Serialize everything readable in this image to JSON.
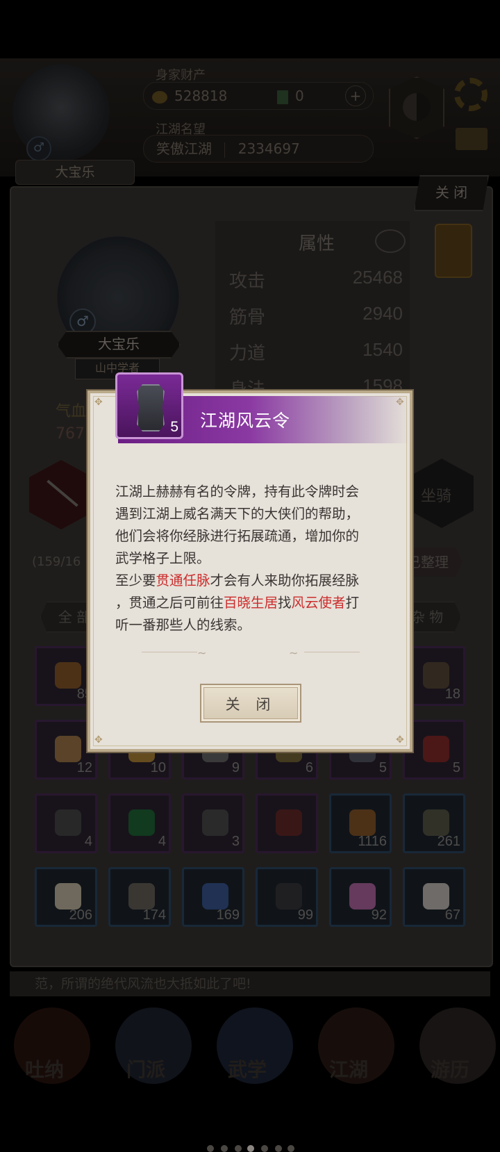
{
  "header": {
    "player_name": "大宝乐",
    "assets_label": "身家财产",
    "coins": "528818",
    "jade": "0",
    "fame_label": "江湖名望",
    "fame_rank": "笑傲江湖",
    "fame_value": "2334697",
    "add_symbol": "+"
  },
  "panel": {
    "close_label": "关 闭",
    "char_name": "大宝乐",
    "char_title": "山中学者",
    "attr_heading": "属性",
    "attributes": [
      {
        "name": "攻击",
        "value": "25468"
      },
      {
        "name": "筋骨",
        "value": "2940"
      },
      {
        "name": "力道",
        "value": "1540"
      },
      {
        "name": "身法",
        "value": "1598"
      }
    ],
    "hp_label": "气血",
    "hp_value": "767",
    "mount_label": "坐骑",
    "bag_count": "(159/16",
    "sort_label": "已整理",
    "filter_all": "全 部",
    "filter_misc": "杂 物"
  },
  "grid": [
    {
      "count": "85",
      "color": "#8a5a2a"
    },
    {
      "count": "",
      "color": ""
    },
    {
      "count": "",
      "color": ""
    },
    {
      "count": "",
      "color": ""
    },
    {
      "count": "",
      "color": ""
    },
    {
      "count": "18",
      "color": "#5a4a3a"
    },
    {
      "count": "12",
      "color": "#a57a4a"
    },
    {
      "count": "10",
      "color": "#b88a3a"
    },
    {
      "count": "9",
      "color": "#6a6a6a"
    },
    {
      "count": "6",
      "color": "#7a6a3a"
    },
    {
      "count": "5",
      "color": "#5a5a6a"
    },
    {
      "count": "5",
      "color": "#8a2a2a"
    },
    {
      "count": "4",
      "color": "#4a4a4a"
    },
    {
      "count": "4",
      "color": "#1f6a3a"
    },
    {
      "count": "3",
      "color": "#4e4e4e"
    },
    {
      "count": "",
      "color": "#6a2a2a"
    },
    {
      "count": "1116",
      "color": "#8a5a2a"
    },
    {
      "count": "261",
      "color": "#5a5a4a"
    },
    {
      "count": "206",
      "color": "#c8bfa8"
    },
    {
      "count": "174",
      "color": "#6a655e"
    },
    {
      "count": "169",
      "color": "#3b5a9a"
    },
    {
      "count": "99",
      "color": "#3a3a3e"
    },
    {
      "count": "92",
      "color": "#b86aa8"
    },
    {
      "count": "67",
      "color": "#c8c3bd"
    }
  ],
  "message_bar": "范，所谓的绝代风流也大抵如此了吧!",
  "nav": [
    "吐纳",
    "门派",
    "武学",
    "江湖",
    "游历"
  ],
  "dialog": {
    "item_name": "江湖风云令",
    "item_count": "5",
    "desc_line1": "江湖上赫赫有名的令牌，持有此令牌时会",
    "desc_line2": "遇到江湖上威名满天下的大侠们的帮助，",
    "desc_line3": "他们会将你经脉进行拓展疏通，增加你的",
    "desc_line4": "武学格子上限。",
    "desc_p2_a": "至少要",
    "desc_p2_hl1": "贯通任脉",
    "desc_p2_b": "才会有人来助你拓展经脉",
    "desc_p3_a": "，贯通之后可前往",
    "desc_p3_hl2": "百晓生居",
    "desc_p3_b": "找",
    "desc_p3_hl3": "风云使者",
    "desc_p3_c": "打",
    "desc_p4": "听一番那些人的线索。",
    "close_label": "关 闭"
  },
  "colors": {
    "dialog_bg": "#e6e1d9",
    "highlight": "#cc2d2d",
    "title_band": "#8a39a2"
  }
}
